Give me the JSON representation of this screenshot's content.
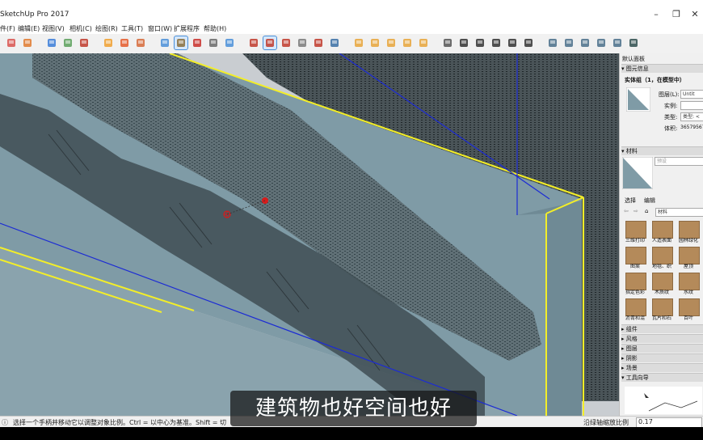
{
  "window": {
    "title": "SketchUp Pro 2017",
    "controls": [
      "minimize",
      "maximize",
      "close"
    ]
  },
  "menu": {
    "items": [
      "件(F)",
      "编辑(E)",
      "视图(V)",
      "相机(C)",
      "绘图(R)",
      "工具(T)",
      "窗口(W)",
      "扩展程序",
      "帮助(H)"
    ]
  },
  "toolbar": {
    "icons": [
      "orbit-icon",
      "open-icon",
      "eraser-icon",
      "paint-icon",
      "arc-icon",
      "push-pull-icon",
      "cloud-icon",
      "cloud-2-icon",
      "select-icon",
      "tape-icon",
      "eraser-2-icon",
      "section-icon",
      "select-2-icon",
      "move-icon",
      "scale-icon",
      "axes-icon",
      "offset-icon",
      "flag-icon",
      "walk-icon",
      "component-1-icon",
      "component-2-icon",
      "component-3-icon",
      "component-4-icon",
      "component-5-icon",
      "iso-view-icon",
      "top-view-icon",
      "front-view-icon",
      "right-view-icon",
      "back-view-icon",
      "left-view-icon",
      "xray-icon",
      "wireframe-icon",
      "hidden-line-icon",
      "shaded-icon",
      "textured-icon",
      "monochrome-icon"
    ]
  },
  "tray": {
    "title": "默认面板",
    "entity_info": {
      "header": "图元信息",
      "summary": "实体组（1，在模型中）",
      "layer_label": "图层(L):",
      "layer_value": "Untit",
      "instance_label": "实例:",
      "instance_value": "",
      "type_label": "类型:",
      "type_value": "类型: <",
      "volume_label": "体积:",
      "volume_value": "36579567"
    },
    "materials": {
      "header": "材料",
      "preview_name": "预设",
      "tab_select": "选择",
      "tab_edit": "编辑",
      "library": "材料",
      "swatches": [
        "三维打印",
        "人造表面",
        "园林绿化",
        "图案",
        "地毯、织",
        "屋顶",
        "指定色彩",
        "木质纹",
        "水纹",
        "沥青和混",
        "瓦片和石",
        "百叶"
      ]
    },
    "collapsed_panels": [
      "组件",
      "风格",
      "图层",
      "阴影",
      "场景"
    ],
    "instructor": {
      "header": "工具向导"
    }
  },
  "status": {
    "info_icon": "info-icon",
    "message": "选择一个手柄并移动它以调整对象比例。Ctrl = 以中心为基准。Shift = 切",
    "measure_label": "沿绿轴缩放比例",
    "measure_value": "0.17"
  },
  "subtitle": "建筑物也好空间也好",
  "colors": {
    "viewport_bg": "#c9cdd1",
    "section_box": "#7f9ba6",
    "selection_yellow": "#f3ee28",
    "blue_axis": "#1c2bd4",
    "point_cloud": "#2b3a40"
  }
}
